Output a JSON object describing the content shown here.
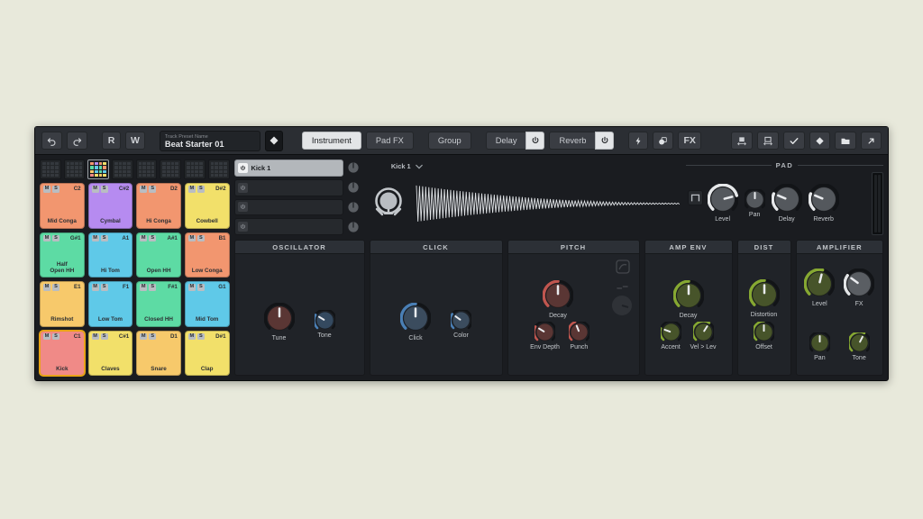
{
  "window": {
    "title": "Drum Synth Plugin",
    "background": "#e8e9db",
    "panel_bg": "#1a1c20"
  },
  "toolbar": {
    "undo_icon": "undo-icon",
    "redo_icon": "redo-icon",
    "read_automation": "R",
    "write_automation": "W",
    "preset": {
      "label": "Track Preset Name",
      "value": "Beat Starter 01",
      "diamond_icon": "diamond-icon"
    },
    "tabs": [
      {
        "label": "Instrument",
        "active": true
      },
      {
        "label": "Pad FX",
        "active": false
      },
      {
        "label": "Group",
        "active": false
      }
    ],
    "fx_slots": [
      {
        "label": "Delay",
        "power": true
      },
      {
        "label": "Reverb",
        "power": true
      }
    ],
    "utility_icons": [
      {
        "name": "lightning-icon",
        "glyph": "⚡"
      },
      {
        "name": "macro-icon",
        "glyph": "◑"
      }
    ],
    "fx_button": "FX",
    "right_icons": [
      {
        "name": "fit-width-icon"
      },
      {
        "name": "fit-height-icon"
      },
      {
        "name": "check-icon"
      },
      {
        "name": "diamond-icon"
      },
      {
        "name": "folder-icon"
      },
      {
        "name": "expand-icon"
      }
    ]
  },
  "pad_banks": {
    "count": 8,
    "active_index": 2,
    "active_colors": [
      "#f2966f",
      "#b68bf0",
      "#f2966f",
      "#f2e06a",
      "#5ddba4",
      "#5fc9e8",
      "#5ddba4",
      "#f2966f",
      "#f7c96b",
      "#5fc9e8",
      "#5ddba4",
      "#5fc9e8",
      "#f08a87",
      "#f2e06a",
      "#f7c96b",
      "#f2e06a"
    ]
  },
  "pads": [
    {
      "mute": "M",
      "solo": "S",
      "note": "C2",
      "name": "Mid Conga",
      "color": "#f2966f",
      "selected": false
    },
    {
      "mute": "M",
      "solo": "S",
      "note": "C#2",
      "name": "Cymbal",
      "color": "#b68bf0",
      "selected": false
    },
    {
      "mute": "M",
      "solo": "S",
      "note": "D2",
      "name": "Hi Conga",
      "color": "#f2966f",
      "selected": false
    },
    {
      "mute": "M",
      "solo": "S",
      "note": "D#2",
      "name": "Cowbell",
      "color": "#f2e06a",
      "selected": false
    },
    {
      "mute": "M",
      "solo": "S",
      "note": "G#1",
      "name": "Half\nOpen HH",
      "color": "#5ddba4",
      "selected": false
    },
    {
      "mute": "M",
      "solo": "S",
      "note": "A1",
      "name": "Hi Tom",
      "color": "#5fc9e8",
      "selected": false
    },
    {
      "mute": "M",
      "solo": "S",
      "note": "A#1",
      "name": "Open HH",
      "color": "#5ddba4",
      "selected": false
    },
    {
      "mute": "M",
      "solo": "S",
      "note": "B1",
      "name": "Low Conga",
      "color": "#f2966f",
      "selected": false
    },
    {
      "mute": "M",
      "solo": "S",
      "note": "E1",
      "name": "Rimshot",
      "color": "#f7c96b",
      "selected": false
    },
    {
      "mute": "M",
      "solo": "S",
      "note": "F1",
      "name": "Low Tom",
      "color": "#5fc9e8",
      "selected": false
    },
    {
      "mute": "M",
      "solo": "S",
      "note": "F#1",
      "name": "Closed HH",
      "color": "#5ddba4",
      "selected": false
    },
    {
      "mute": "M",
      "solo": "S",
      "note": "G1",
      "name": "Mid Tom",
      "color": "#5fc9e8",
      "selected": false
    },
    {
      "mute": "M",
      "solo": "S",
      "note": "C1",
      "name": "Kick",
      "color": "#f08a87",
      "selected": true
    },
    {
      "mute": "M",
      "solo": "S",
      "note": "C#1",
      "name": "Claves",
      "color": "#f2e06a",
      "selected": false
    },
    {
      "mute": "M",
      "solo": "S",
      "note": "D1",
      "name": "Snare",
      "color": "#f7c96b",
      "selected": false
    },
    {
      "mute": "M",
      "solo": "S",
      "note": "D#1",
      "name": "Clap",
      "color": "#f2e06a",
      "selected": false
    }
  ],
  "layers": [
    {
      "name": "Kick 1",
      "on": true
    },
    {
      "name": "",
      "on": false
    },
    {
      "name": "",
      "on": false
    },
    {
      "name": "",
      "on": false
    }
  ],
  "waveform": {
    "source_name": "Kick 1",
    "dropdown_icon": "chevron-down-icon",
    "instrument_icon": "kick-drum-icon"
  },
  "pad_section": {
    "title": "PAD",
    "wave_button_icon": "square-wave-icon",
    "knobs": [
      {
        "label": "Level",
        "value": 78,
        "color": "#e6e8ea",
        "size": "large",
        "style": "arc"
      },
      {
        "label": "Pan",
        "value": 50,
        "color": "#cfd3d7",
        "size": "small",
        "style": "center"
      },
      {
        "label": "Delay",
        "value": 25,
        "color": "#e6e8ea",
        "size": "large",
        "style": "arc"
      },
      {
        "label": "Reverb",
        "value": 25,
        "color": "#e6e8ea",
        "size": "large",
        "style": "arc"
      }
    ],
    "meter_label": "output-level-meter"
  },
  "modules": [
    {
      "title": "OSCILLATOR",
      "accent": "#c0564f",
      "knobs": [
        {
          "label": "Tune",
          "value": 50,
          "size": "large",
          "style": "center",
          "accent": "#c0564f",
          "fill": "#5a3634"
        },
        {
          "label": "Tone",
          "value": 28,
          "size": "small",
          "style": "arc",
          "accent": "#4a7fb5",
          "fill": "#34495f"
        }
      ]
    },
    {
      "title": "CLICK",
      "accent": "#4a7fb5",
      "knobs": [
        {
          "label": "Click",
          "value": 50,
          "size": "large",
          "style": "arc",
          "accent": "#4a7fb5",
          "fill": "#3b4c5e"
        },
        {
          "label": "Color",
          "value": 30,
          "size": "small",
          "style": "arc",
          "accent": "#4a7fb5",
          "fill": "#3b4c5e"
        }
      ]
    },
    {
      "title": "PITCH",
      "accent": "#c0564f",
      "knobs": [
        {
          "label": "Decay",
          "value": 50,
          "size": "large",
          "style": "arc",
          "accent": "#c0564f",
          "fill": "#5a3634"
        },
        {
          "label": "Env Depth",
          "value": 28,
          "size": "small",
          "style": "arc",
          "accent": "#c0564f",
          "fill": "#5a3634"
        },
        {
          "label": "Punch",
          "value": 42,
          "size": "small",
          "style": "arc",
          "accent": "#c0564f",
          "fill": "#5a3634"
        }
      ],
      "ghost_icons": [
        "pitch-curve-icon",
        "pitch-mode-icon",
        "pitch-dial-icon"
      ]
    },
    {
      "title": "AMP ENV",
      "accent": "#86a832",
      "knobs": [
        {
          "label": "Decay",
          "value": 50,
          "size": "large",
          "style": "arc",
          "accent": "#86a832",
          "fill": "#47542a"
        },
        {
          "label": "Accent",
          "value": 24,
          "size": "small",
          "style": "arc",
          "accent": "#86a832",
          "fill": "#47542a"
        },
        {
          "label": "Vel > Lev",
          "value": 62,
          "size": "small",
          "style": "arc",
          "accent": "#86a832",
          "fill": "#47542a"
        }
      ]
    },
    {
      "title": "DIST",
      "accent": "#86a832",
      "knobs": [
        {
          "label": "Distortion",
          "value": 50,
          "size": "large",
          "style": "arc",
          "accent": "#86a832",
          "fill": "#47542a"
        },
        {
          "label": "Offset",
          "value": 50,
          "size": "small",
          "style": "arc",
          "accent": "#86a832",
          "fill": "#47542a"
        }
      ]
    },
    {
      "title": "AMPLIFIER",
      "accent": "#86a832",
      "knobs": [
        {
          "label": "Level",
          "value": 55,
          "size": "large",
          "style": "arc",
          "accent": "#86a832",
          "fill": "#47542a"
        },
        {
          "label": "FX",
          "value": 30,
          "size": "large",
          "style": "arc",
          "accent": "#e3e5e7",
          "fill": "#5a5e63"
        },
        {
          "label": "Pan",
          "value": 50,
          "size": "small",
          "style": "center",
          "accent": "#86a832",
          "fill": "#47542a"
        },
        {
          "label": "Tone",
          "value": 60,
          "size": "small",
          "style": "arc",
          "accent": "#86a832",
          "fill": "#47542a"
        }
      ]
    }
  ]
}
